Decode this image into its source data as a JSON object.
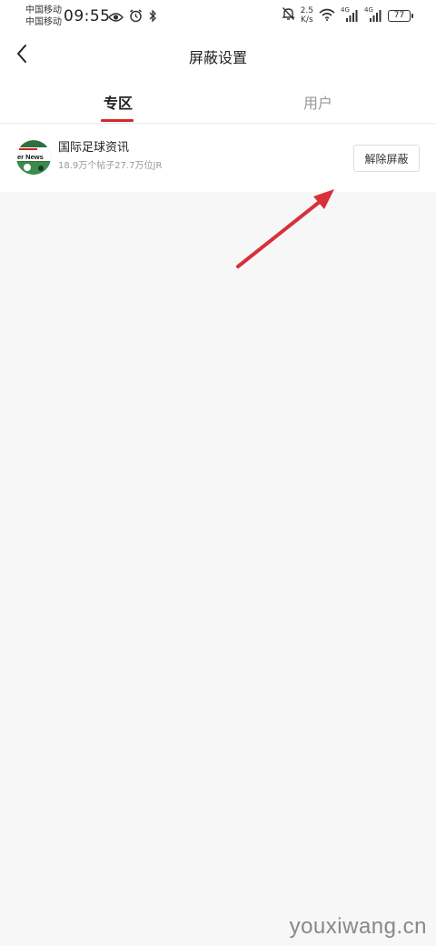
{
  "status_bar": {
    "carrier_1": "中国移动",
    "carrier_2": "中国移动",
    "time": "09:55",
    "net_speed_value": "2.5",
    "net_speed_unit": "K/s",
    "signal_1_label": "4G",
    "signal_2_label": "4G",
    "battery": "77",
    "icons": [
      "eye-icon",
      "alarm-icon",
      "bluetooth-icon",
      "mute-icon",
      "wifi-icon",
      "signal-icon",
      "battery-icon"
    ]
  },
  "header": {
    "title": "屏蔽设置"
  },
  "tabs": [
    {
      "label": "专区",
      "active": true
    },
    {
      "label": "用户",
      "active": false
    }
  ],
  "blocked_zones": [
    {
      "name": "国际足球资讯",
      "meta": "18.9万个帖子27.7万位JR",
      "thumb_text": "er News",
      "action_label": "解除屏蔽"
    }
  ],
  "watermark": "youxiwang.cn",
  "colors": {
    "accent": "#d42a2a",
    "background": "#f7f7f7",
    "surface": "#ffffff",
    "muted_text": "#999999"
  }
}
